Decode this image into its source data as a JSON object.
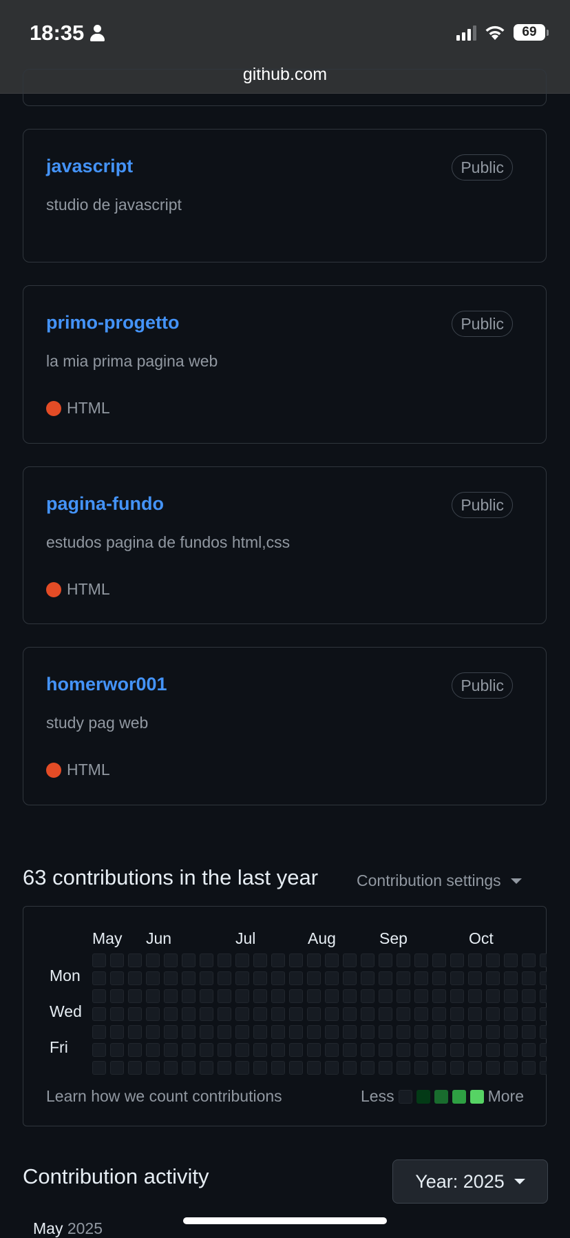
{
  "status_bar": {
    "time": "18:35",
    "battery": "69"
  },
  "browser": {
    "url": "github.com"
  },
  "repos": [
    {
      "name": "javascript",
      "visibility": "Public",
      "description": "studio de javascript",
      "language": "",
      "language_color": ""
    },
    {
      "name": "primo-progetto",
      "visibility": "Public",
      "description": "la mia prima pagina web",
      "language": "HTML",
      "language_color": "#e34c26"
    },
    {
      "name": "pagina-fundo",
      "visibility": "Public",
      "description": "estudos pagina de fundos html,css",
      "language": "HTML",
      "language_color": "#e34c26"
    },
    {
      "name": "homerwor001",
      "visibility": "Public",
      "description": "study pag web",
      "language": "HTML",
      "language_color": "#e34c26"
    }
  ],
  "contributions": {
    "title": "63 contributions in the last year",
    "settings_label": "Contribution settings",
    "months": [
      "May",
      "Jun",
      "Jul",
      "Aug",
      "Sep",
      "Oct"
    ],
    "days": [
      "Mon",
      "Wed",
      "Fri"
    ],
    "learn_link": "Learn how we count contributions",
    "legend_less": "Less",
    "legend_more": "More",
    "legend_colors": [
      "#161b22",
      "#033a16",
      "#196c2e",
      "#2ea043",
      "#56d364"
    ]
  },
  "activity": {
    "title": "Contribution activity",
    "year_label": "Year: 2025",
    "month_heading": "May",
    "month_year": "2025"
  }
}
